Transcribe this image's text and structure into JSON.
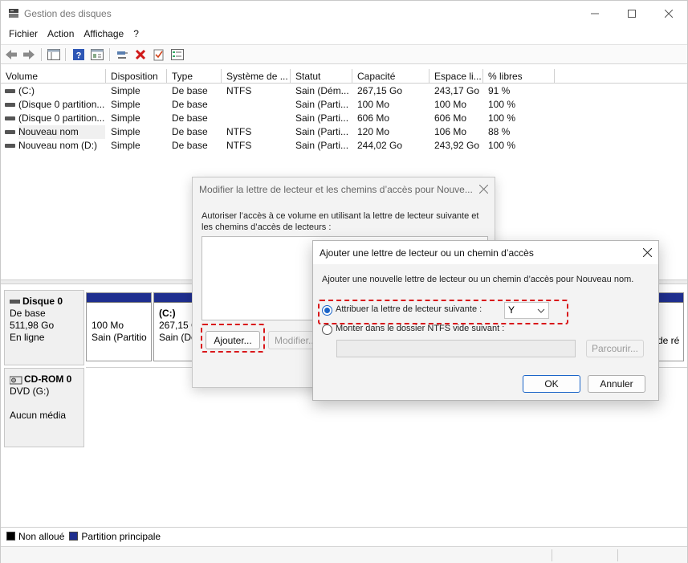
{
  "window": {
    "title": "Gestion des disques"
  },
  "menu": [
    "Fichier",
    "Action",
    "Affichage",
    "?"
  ],
  "toolbar": {
    "icons": [
      "back-icon",
      "forward-icon",
      "console-tree-icon",
      "help-icon",
      "properties-icon",
      "connect-icon",
      "delete-icon",
      "check-icon",
      "list-icon"
    ]
  },
  "volumes": {
    "headers": [
      "Volume",
      "Disposition",
      "Type",
      "Système de ...",
      "Statut",
      "Capacité",
      "Espace li...",
      "% libres"
    ],
    "rows": [
      [
        "(C:)",
        "Simple",
        "De base",
        "NTFS",
        "Sain (Dém...",
        "267,15 Go",
        "243,17 Go",
        "91 %"
      ],
      [
        "(Disque 0 partition...",
        "Simple",
        "De base",
        "",
        "Sain (Parti...",
        "100 Mo",
        "100 Mo",
        "100 %"
      ],
      [
        "(Disque 0 partition...",
        "Simple",
        "De base",
        "",
        "Sain (Parti...",
        "606 Mo",
        "606 Mo",
        "100 %"
      ],
      [
        "Nouveau nom",
        "Simple",
        "De base",
        "NTFS",
        "Sain (Parti...",
        "120 Mo",
        "106 Mo",
        "88 %"
      ],
      [
        "Nouveau nom (D:)",
        "Simple",
        "De base",
        "NTFS",
        "Sain (Parti...",
        "244,02 Go",
        "243,92 Go",
        "100 %"
      ]
    ]
  },
  "disks": {
    "disk0": {
      "name": "Disque 0",
      "type": "De base",
      "size": "511,98 Go",
      "state": "En ligne",
      "part1": {
        "size": "100 Mo",
        "status": "Sain (Partitio"
      },
      "part2": {
        "name": "(C:)",
        "size": "267,15 G",
        "status": "Sain (Dé"
      },
      "part_last": {
        "status_tail": "de ré"
      }
    },
    "cdrom0": {
      "name": "CD-ROM 0",
      "drive": "DVD (G:)",
      "media": "Aucun média"
    }
  },
  "legend": {
    "unallocated": "Non alloué",
    "primary": "Partition principale",
    "colors": {
      "unallocated": "#000000",
      "primary": "#1f2f8f"
    }
  },
  "dialog_paths": {
    "title": "Modifier la lettre de lecteur et les chemins d’accès pour Nouve...",
    "description": "Autoriser l’accès à ce volume en utilisant la lettre de lecteur suivante et les chemins d’accès de lecteurs :",
    "add_button": "Ajouter...",
    "modify_button": "Modifier..."
  },
  "dialog_add": {
    "title": "Ajouter une lettre de lecteur ou un chemin d’accès",
    "description": "Ajouter une nouvelle lettre de lecteur ou un chemin d’accès pour Nouveau nom.",
    "option_letter": "Attribuer la lettre de lecteur suivante :",
    "letter_value": "Y",
    "option_folder": "Monter dans le dossier NTFS vide suivant :",
    "browse_button": "Parcourir...",
    "ok_button": "OK",
    "cancel_button": "Annuler"
  },
  "colors": {
    "highlight": "#d9171a",
    "accent": "#1a64c8"
  }
}
